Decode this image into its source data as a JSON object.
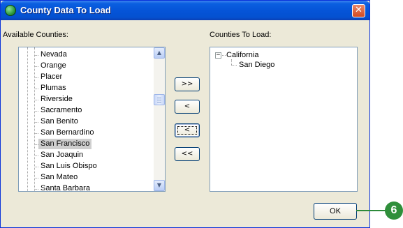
{
  "window": {
    "title": "County Data To Load",
    "close_glyph": "✕",
    "title_icon": "globe-icon"
  },
  "available": {
    "label": "Available Counties:",
    "items": [
      {
        "label": "Nevada",
        "selected": false
      },
      {
        "label": "Orange",
        "selected": false
      },
      {
        "label": "Placer",
        "selected": false
      },
      {
        "label": "Plumas",
        "selected": false
      },
      {
        "label": "Riverside",
        "selected": false
      },
      {
        "label": "Sacramento",
        "selected": false
      },
      {
        "label": "San Benito",
        "selected": false
      },
      {
        "label": "San Bernardino",
        "selected": false
      },
      {
        "label": "San Francisco",
        "selected": true
      },
      {
        "label": "San Joaquin",
        "selected": false
      },
      {
        "label": "San Luis Obispo",
        "selected": false
      },
      {
        "label": "San Mateo",
        "selected": false
      },
      {
        "label": "Santa Barbara",
        "selected": false
      }
    ],
    "scroll_up_glyph": "▲",
    "scroll_down_glyph": "▼"
  },
  "transfer_buttons": {
    "add_all": ">>",
    "remove": "<",
    "remove_focused": "<",
    "remove_all": "<<"
  },
  "to_load": {
    "label": "Counties To Load:",
    "root": "California",
    "expander_glyph": "−",
    "children": [
      "San Diego"
    ]
  },
  "ok_button": "OK",
  "callout": {
    "number": "6",
    "color": "#2f8f3b"
  }
}
